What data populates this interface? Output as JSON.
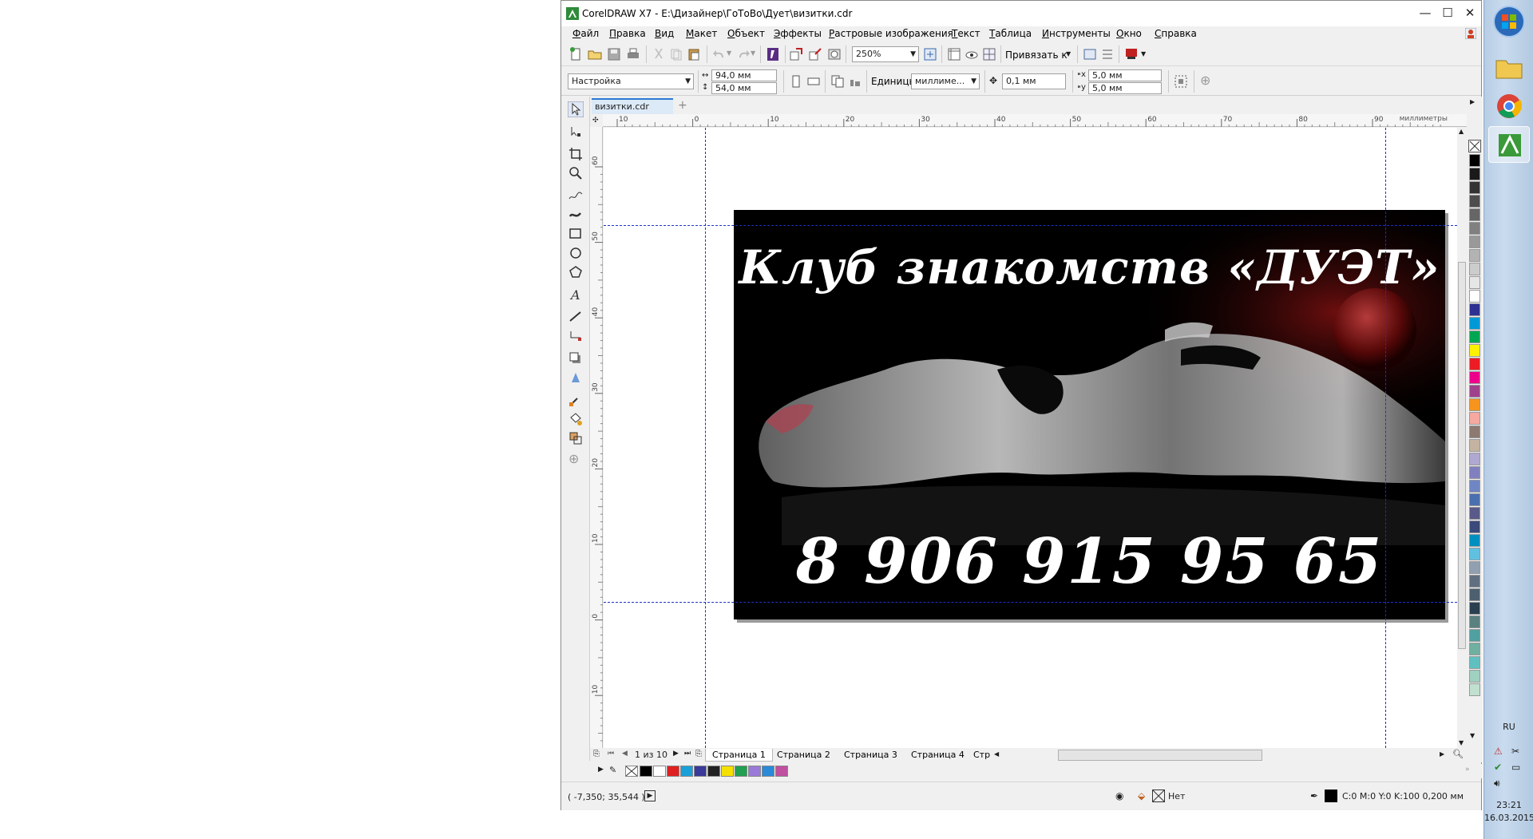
{
  "window": {
    "title": "CorelDRAW X7 - E:\\Дизайнер\\ГоТоВо\\Дует\\визитки.cdr",
    "minimize": "—",
    "maximize": "☐",
    "close": "✕"
  },
  "menu": [
    "Файл",
    "Правка",
    "Вид",
    "Макет",
    "Объект",
    "Эффекты",
    "Растровые изображения",
    "Текст",
    "Таблица",
    "Инструменты",
    "Окно",
    "Справка"
  ],
  "toolbar": {
    "zoom": "250%",
    "snap_label": "Привязать к"
  },
  "property_bar": {
    "preset": "Настройка",
    "width": "94,0 мм",
    "height": "54,0 мм",
    "units_label": "Единицы:",
    "units_value": "миллиме...",
    "nudge": "0,1 мм",
    "dup_x": "5,0 мм",
    "dup_y": "5,0 мм"
  },
  "document_tab": "визитки.cdr",
  "ruler": {
    "unit": "миллиметры",
    "h_ticks": [
      "10",
      "0",
      "10",
      "20",
      "30",
      "40",
      "50",
      "60",
      "70",
      "80",
      "90"
    ],
    "v_ticks": [
      "60",
      "50",
      "40",
      "30",
      "20",
      "10",
      "0",
      "10"
    ]
  },
  "card": {
    "title": "Клуб знакомств «ДУЭТ»",
    "phone": "8 906 915 95 65"
  },
  "pages": {
    "counter": "1 из 10",
    "tabs": [
      "Страница 1",
      "Страница 2",
      "Страница 3",
      "Страница 4",
      "Стр"
    ]
  },
  "document_palette": [
    "#000000",
    "#ffffff",
    "#e02020",
    "#1aa0d8",
    "#3a3a9a",
    "#222222",
    "#f5e000",
    "#20a050",
    "#9a7ad8",
    "#2a8ad8",
    "#c050a0"
  ],
  "color_palette": [
    "#000000",
    "#1a1a1a",
    "#333333",
    "#4d4d4d",
    "#666666",
    "#808080",
    "#999999",
    "#b3b3b3",
    "#cccccc",
    "#e6e6e6",
    "#ffffff",
    "#2e3192",
    "#0099d8",
    "#00a651",
    "#fff200",
    "#ed1c24",
    "#ec008c",
    "#a0428b",
    "#f7941d",
    "#f5a9a0",
    "#8c7a70",
    "#c4b3a0",
    "#b0a8d0",
    "#8080c0",
    "#6f86c4",
    "#4a6fb0",
    "#5a5a8a",
    "#3a4a7a",
    "#0090c0",
    "#60c0e0",
    "#90a0b0",
    "#607080",
    "#4d6070",
    "#2a4050",
    "#5a8080",
    "#50a0a0",
    "#70b0a0",
    "#60c0c0",
    "#a0d0c0",
    "#c0e0d0"
  ],
  "status": {
    "coords": "( -7,350; 35,544 )",
    "fill_none": "Нет",
    "outline": "C:0 M:0 Y:0 K:100  0,200 мм"
  },
  "taskbar": {
    "lang": "RU",
    "time": "23:21",
    "date": "16.03.2015"
  }
}
